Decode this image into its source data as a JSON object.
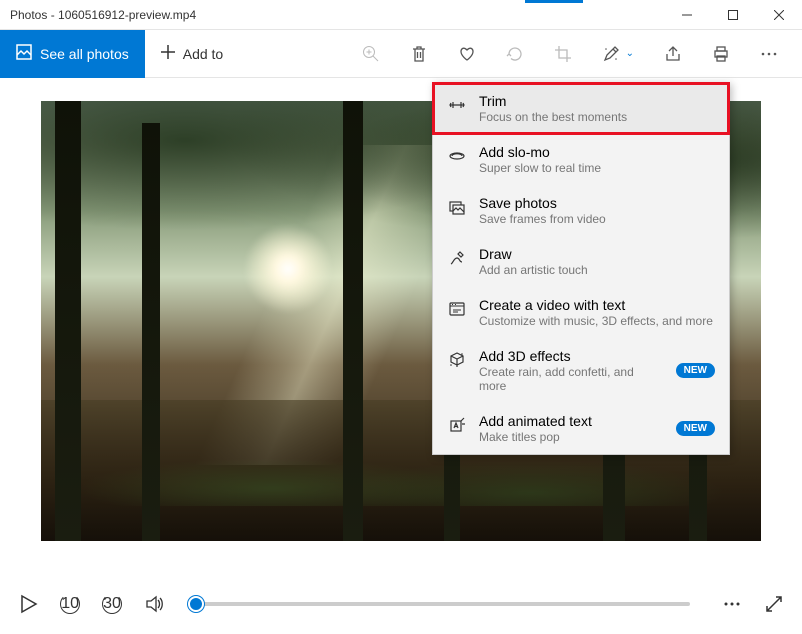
{
  "window": {
    "title": "Photos - 1060516912-preview.mp4"
  },
  "toolbar": {
    "see_all": "See all photos",
    "add_to": "Add to"
  },
  "dropdown": [
    {
      "icon": "trim",
      "title": "Trim",
      "sub": "Focus on the best moments",
      "highlighted": true
    },
    {
      "icon": "slomo",
      "title": "Add slo-mo",
      "sub": "Super slow to real time"
    },
    {
      "icon": "savephotos",
      "title": "Save photos",
      "sub": "Save frames from video"
    },
    {
      "icon": "draw",
      "title": "Draw",
      "sub": "Add an artistic touch"
    },
    {
      "icon": "videotext",
      "title": "Create a video with text",
      "sub": "Customize with music, 3D effects, and more"
    },
    {
      "icon": "3d",
      "title": "Add 3D effects",
      "sub": "Create rain, add confetti, and more",
      "badge": "NEW"
    },
    {
      "icon": "animtext",
      "title": "Add animated text",
      "sub": "Make titles pop",
      "badge": "NEW"
    }
  ],
  "skip": {
    "back": "10",
    "fwd": "30"
  }
}
